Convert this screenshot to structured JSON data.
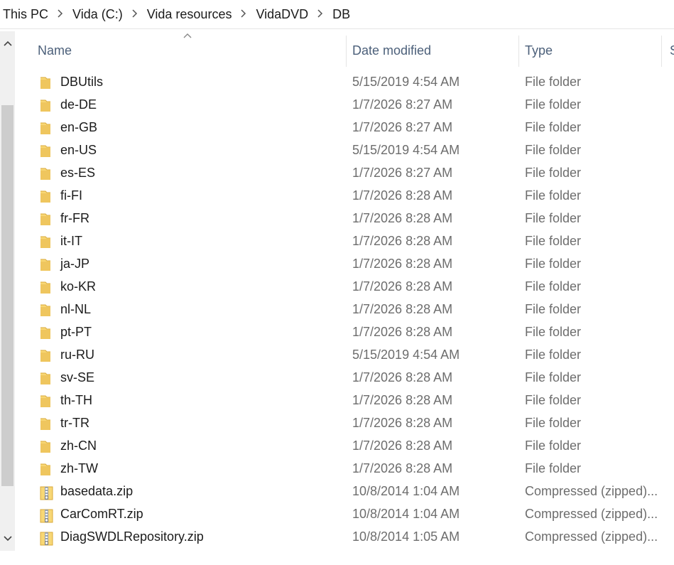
{
  "breadcrumb": [
    "This PC",
    "Vida (C:)",
    "Vida resources",
    "VidaDVD",
    "DB"
  ],
  "columns": {
    "name": "Name",
    "date": "Date modified",
    "type": "Type",
    "size": "S"
  },
  "colors": {
    "folder": "#f8d775",
    "header_text": "#4c607a",
    "meta_text": "#6d6d6d"
  },
  "files": [
    {
      "name": "DBUtils",
      "date": "5/15/2019 4:54 AM",
      "type": "File folder",
      "icon": "folder-icon"
    },
    {
      "name": "de-DE",
      "date": "1/7/2026 8:27 AM",
      "type": "File folder",
      "icon": "folder-icon"
    },
    {
      "name": "en-GB",
      "date": "1/7/2026 8:27 AM",
      "type": "File folder",
      "icon": "folder-icon"
    },
    {
      "name": "en-US",
      "date": "5/15/2019 4:54 AM",
      "type": "File folder",
      "icon": "folder-icon"
    },
    {
      "name": "es-ES",
      "date": "1/7/2026 8:27 AM",
      "type": "File folder",
      "icon": "folder-icon"
    },
    {
      "name": "fi-FI",
      "date": "1/7/2026 8:28 AM",
      "type": "File folder",
      "icon": "folder-icon"
    },
    {
      "name": "fr-FR",
      "date": "1/7/2026 8:28 AM",
      "type": "File folder",
      "icon": "folder-icon"
    },
    {
      "name": "it-IT",
      "date": "1/7/2026 8:28 AM",
      "type": "File folder",
      "icon": "folder-icon"
    },
    {
      "name": "ja-JP",
      "date": "1/7/2026 8:28 AM",
      "type": "File folder",
      "icon": "folder-icon"
    },
    {
      "name": "ko-KR",
      "date": "1/7/2026 8:28 AM",
      "type": "File folder",
      "icon": "folder-icon"
    },
    {
      "name": "nl-NL",
      "date": "1/7/2026 8:28 AM",
      "type": "File folder",
      "icon": "folder-icon"
    },
    {
      "name": "pt-PT",
      "date": "1/7/2026 8:28 AM",
      "type": "File folder",
      "icon": "folder-icon"
    },
    {
      "name": "ru-RU",
      "date": "5/15/2019 4:54 AM",
      "type": "File folder",
      "icon": "folder-icon"
    },
    {
      "name": "sv-SE",
      "date": "1/7/2026 8:28 AM",
      "type": "File folder",
      "icon": "folder-icon"
    },
    {
      "name": "th-TH",
      "date": "1/7/2026 8:28 AM",
      "type": "File folder",
      "icon": "folder-icon"
    },
    {
      "name": "tr-TR",
      "date": "1/7/2026 8:28 AM",
      "type": "File folder",
      "icon": "folder-icon"
    },
    {
      "name": "zh-CN",
      "date": "1/7/2026 8:28 AM",
      "type": "File folder",
      "icon": "folder-icon"
    },
    {
      "name": "zh-TW",
      "date": "1/7/2026 8:28 AM",
      "type": "File folder",
      "icon": "folder-icon"
    },
    {
      "name": "basedata.zip",
      "date": "10/8/2014 1:04 AM",
      "type": "Compressed (zipped)...",
      "icon": "zip-folder-icon"
    },
    {
      "name": "CarComRT.zip",
      "date": "10/8/2014 1:04 AM",
      "type": "Compressed (zipped)...",
      "icon": "zip-folder-icon"
    },
    {
      "name": "DiagSWDLRepository.zip",
      "date": "10/8/2014 1:05 AM",
      "type": "Compressed (zipped)...",
      "icon": "zip-folder-icon"
    }
  ]
}
